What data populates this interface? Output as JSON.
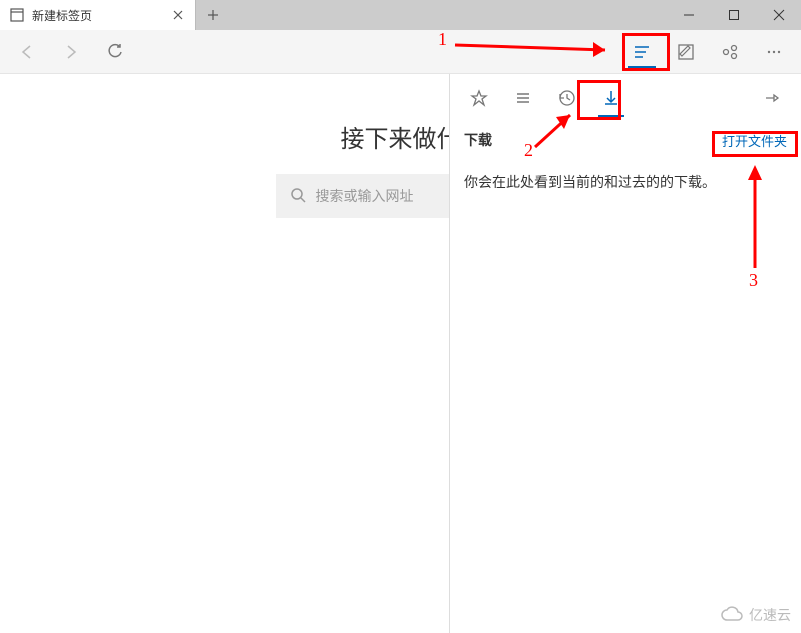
{
  "tab": {
    "title": "新建标签页"
  },
  "window_controls": {
    "minimize": "—",
    "maximize": "☐",
    "close": "✕"
  },
  "content": {
    "headline": "接下来做什",
    "search_placeholder": "搜索或输入网址"
  },
  "hub": {
    "title": "下载",
    "open_folder": "打开文件夹",
    "empty_message": "你会在此处看到当前的和过去的的下载。"
  },
  "annotations": {
    "a1": "1",
    "a2": "2",
    "a3": "3"
  },
  "watermark": "亿速云"
}
